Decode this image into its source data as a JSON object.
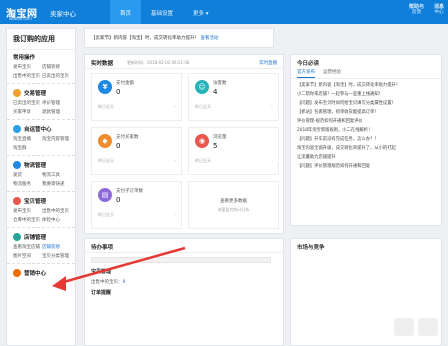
{
  "header": {
    "logo": "淘宝网",
    "logo_sub": "Taobao.com",
    "center_title": "卖家中心",
    "tabs": [
      "首页",
      "基础设置",
      "更多"
    ],
    "right_items": [
      {
        "top": "帮助与",
        "bottom": "反馈"
      },
      {
        "top": "消息",
        "bottom": "中心"
      }
    ]
  },
  "sidebar": {
    "title": "我订购的应用",
    "sections": [
      {
        "name": "常用操作",
        "items": [
          "发布宝贝",
          "店铺装修",
          "出售中的宝贝",
          "已卖出的宝贝",
          "交易管理",
          "店铺管理"
        ]
      },
      {
        "name": "交易管理",
        "items": [
          "已卖出的宝贝",
          "评价管理",
          "买家申诉",
          "退款管理"
        ]
      },
      {
        "name": "自运营中心",
        "items": [
          "淘宝直播",
          "淘宝内容管理",
          "淘宝群"
        ]
      },
      {
        "name": "物流管理",
        "items": [
          "发货",
          "物流工具",
          "物流服务",
          "我要寄快递"
        ]
      },
      {
        "name": "宝贝管理",
        "items": [
          "发布宝贝",
          "出售中的宝贝",
          "仓库中的宝贝",
          "体检中心"
        ]
      },
      {
        "name": "店铺管理",
        "items": [
          "查看淘宝店铺",
          "店铺装修",
          "图片空间",
          "宝贝分类管理"
        ]
      },
      {
        "name": "营销中心",
        "items": []
      }
    ]
  },
  "notice": {
    "text": "【卖家节】新内容【淘宝】时，成交转化率助力提升！",
    "link": "查看活动"
  },
  "realtime": {
    "title": "实时数据",
    "time": "更新时间：2018-02-02 09:21:08",
    "link": "实时直播",
    "cards": [
      {
        "label": "支付金额",
        "value": "0",
        "foot": "昨日全天",
        "icon": "¥",
        "color": "#1e88e5"
      },
      {
        "label": "访客数",
        "value": "4",
        "foot": "昨日全天",
        "icon": "☺",
        "color": "#26b4b8"
      },
      {
        "label": "支付买家数",
        "value": "0",
        "foot": "昨日全天",
        "icon": "◆",
        "color": "#f08c2e"
      },
      {
        "label": "浏览量",
        "value": "5",
        "foot": "昨日全天",
        "icon": "◉",
        "color": "#e8584c"
      },
      {
        "label": "支付子订单数",
        "value": "0",
        "foot": "昨日全天",
        "icon": "▤",
        "color": "#8e6bd9"
      }
    ],
    "more_label": "查看更多数据",
    "more_sub": "流量监控统计分析"
  },
  "todo": {
    "title": "待办事项",
    "rows": [
      {
        "label": "宝贝管理"
      },
      {
        "label": "出售中的宝贝：",
        "count": "9"
      },
      {
        "label": "订单提醒"
      }
    ]
  },
  "tips": {
    "title": "今日必读",
    "tabs": [
      "官方发布",
      "运营经验"
    ],
    "items": [
      "【卖家节】新内容【淘宝】时，成交转化率助力提升！",
      "小二帮你来店铺！一起参与一些重上线通知！",
      "【问题】发布宝贝时如何给宝贝填写分类属性设置！",
      "【抓站】包裹管理，抓单收货能提高订单！",
      "评价管理·规范如何开通和回复评价",
      "2018年淘宝新版规则，小二在线解析！",
      "【问题】开车前没有完成任务，怎么办？！",
      "淘宝内容全面升级，成交转化率提升了，从小的打起",
      "让流量助力店铺提升",
      "【问题】评价管理规范如何开通和回复"
    ]
  },
  "market": {
    "title": "市场与竞争"
  },
  "colors": {
    "primary": "#0f7fd9",
    "accent": "#1a73c9",
    "arrow": "#e53935"
  }
}
